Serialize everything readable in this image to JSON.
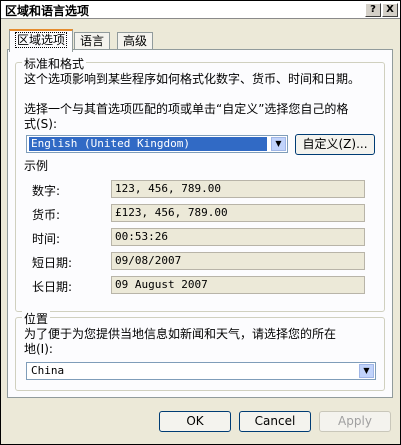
{
  "window": {
    "title": "区域和语言选项",
    "help_glyph": "?",
    "close_glyph": "X"
  },
  "tabs": [
    {
      "label": "区域选项",
      "active": true
    },
    {
      "label": "语言",
      "active": false
    },
    {
      "label": "高级",
      "active": false
    }
  ],
  "standards": {
    "group_title": "标准和格式",
    "description": "这个选项影响到某些程序如何格式化数字、货币、时间和日期。",
    "prompt_line1": "选择一个与其首选项匹配的项或单击“自定义”选择您自己的格",
    "prompt_line2": "式(S):",
    "selected_locale": "English (United Kingdom)",
    "customize_label": "自定义(Z)..."
  },
  "samples": {
    "title": "示例",
    "rows": [
      {
        "label": "数字:",
        "value": "123, 456, 789.00"
      },
      {
        "label": "货币:",
        "value": "£123, 456, 789.00"
      },
      {
        "label": "时间:",
        "value": "00:53:26"
      },
      {
        "label": "短日期:",
        "value": "09/08/2007"
      },
      {
        "label": "长日期:",
        "value": "09 August 2007"
      }
    ]
  },
  "location": {
    "group_title": "位置",
    "prompt_line1": "为了便于为您提供当地信息如新闻和天气，请选择您的所在",
    "prompt_line2": "地(I):",
    "selected": "China"
  },
  "footer": {
    "ok_label": "OK",
    "cancel_label": "Cancel",
    "apply_label": "Apply"
  }
}
